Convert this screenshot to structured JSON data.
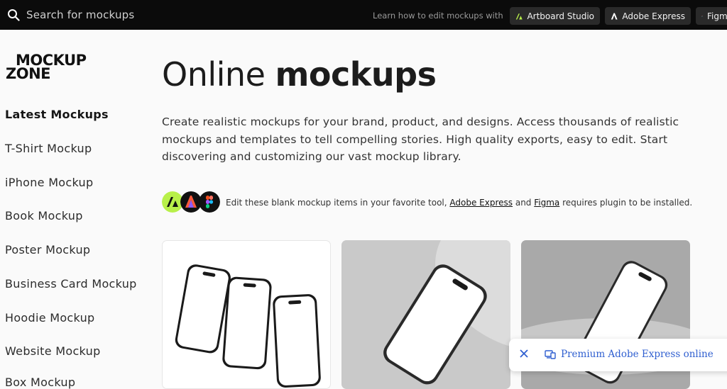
{
  "topbar": {
    "search_placeholder": "Search for mockups",
    "learn_text": "Learn how to edit mockups with",
    "buttons": [
      {
        "label": "Artboard Studio",
        "icon": "artboard-icon"
      },
      {
        "label": "Adobe Express",
        "icon": "adobe-express-icon"
      },
      {
        "label": "Figma",
        "icon": "figma-icon"
      }
    ]
  },
  "logo": {
    "line1": "MOCKUP",
    "line2": "ZONE"
  },
  "sidebar": {
    "items": [
      {
        "label": "Latest Mockups"
      },
      {
        "label": "T-Shirt Mockup"
      },
      {
        "label": "iPhone Mockup"
      },
      {
        "label": "Book Mockup"
      },
      {
        "label": "Poster Mockup"
      },
      {
        "label": "Business Card Mockup"
      },
      {
        "label": "Hoodie Mockup"
      },
      {
        "label": "Website Mockup"
      },
      {
        "label": "Box Mockup"
      }
    ]
  },
  "main": {
    "title_light": "Online ",
    "title_bold": "mockups",
    "description": "Create realistic mockups for your brand, product, and designs. Access thousands of realistic mockups and templates to tell compelling stories. High quality exports, easy to edit. Start discovering and customizing our vast mockup library.",
    "tools_prefix": "Edit these blank mockup items in your favorite tool, ",
    "tools_link1": "Adobe Express",
    "tools_and": " and ",
    "tools_link2": "Figma",
    "tools_suffix": " requires plugin to be installed."
  },
  "toast": {
    "text": "Premium Adobe Express online"
  },
  "colors": {
    "topbar": "#0b0b0b",
    "artboard": "#b8f04a",
    "adobe": "#e83b2c",
    "link": "#2f5fd0"
  }
}
